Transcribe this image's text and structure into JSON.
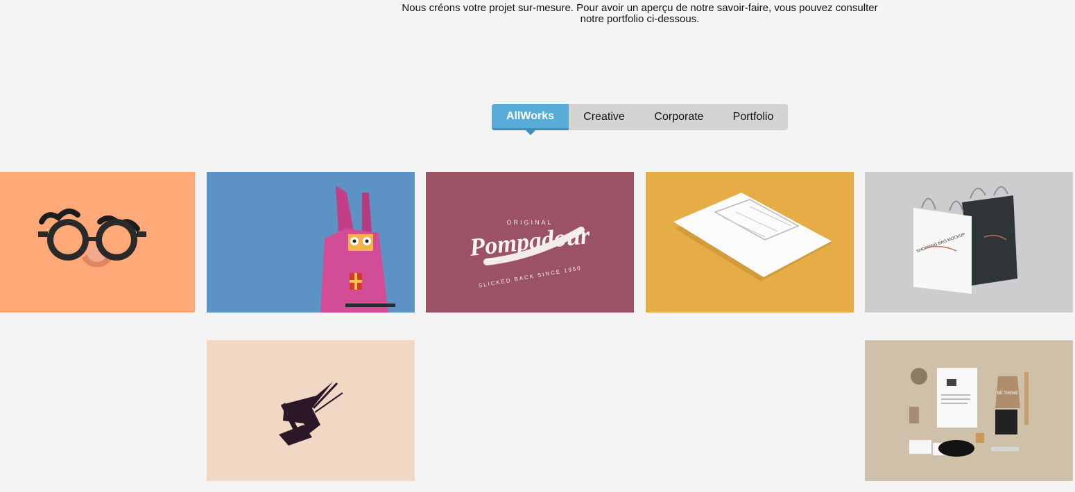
{
  "intro": {
    "line1": "Nous créons votre projet sur-mesure. Pour avoir un aperçu de notre savoir-faire, vous pouvez consulter",
    "line2": "notre portfolio ci-dessous."
  },
  "filters": {
    "active": "AllWorks",
    "items": [
      "AllWorks",
      "Creative",
      "Corporate",
      "Portfolio"
    ]
  },
  "colors": {
    "accent": "#5aacd8",
    "tab_bar": "#d4d4d4",
    "tile_orange": "#ffa878",
    "tile_blue": "#5d93c4",
    "tile_burgundy": "#9a5264",
    "tile_yellow": "#e6ad46",
    "tile_gray": "#cdcdcf",
    "tile_peach": "#f0d8c4",
    "tile_tan": "#cfc0aa"
  },
  "portfolio": {
    "tile_3": {
      "text_top": "ORIGINAL",
      "text_main": "Pompadour",
      "text_bottom": "SLICKED BACK SINCE 1950"
    },
    "tile_5": {
      "bag_text": "SHOPPING BAG MOCKUP"
    },
    "tile_7": {
      "card_text": "BE THEME"
    }
  }
}
